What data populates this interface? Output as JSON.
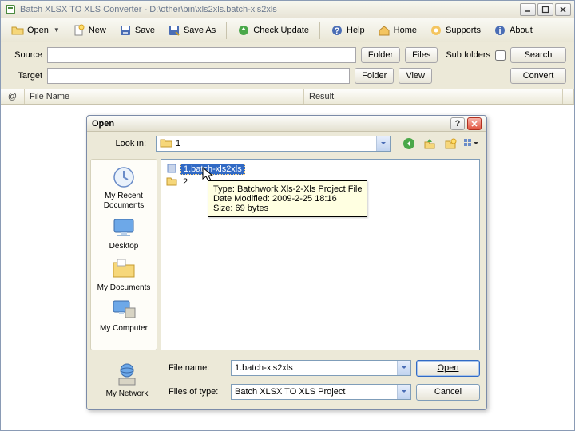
{
  "title": "Batch XLSX TO XLS Converter - D:\\other\\bin\\xls2xls.batch-xls2xls",
  "toolbar": {
    "open": "Open",
    "new": "New",
    "save": "Save",
    "save_as": "Save As",
    "check_update": "Check Update",
    "help": "Help",
    "home": "Home",
    "supports": "Supports",
    "about": "About"
  },
  "rows": {
    "source": "Source",
    "target": "Target",
    "folder": "Folder",
    "files": "Files",
    "subfolders": "Sub folders",
    "search": "Search",
    "view": "View",
    "convert": "Convert"
  },
  "grid": {
    "at": "@",
    "filename": "File Name",
    "result": "Result"
  },
  "dialog": {
    "title": "Open",
    "look_in": "Look in:",
    "look_in_value": "1",
    "places": {
      "recent": "My Recent Documents",
      "desktop": "Desktop",
      "docs": "My Documents",
      "computer": "My Computer",
      "network": "My Network"
    },
    "files": [
      {
        "name": "1.batch-xls2xls",
        "type": "project",
        "selected": true
      },
      {
        "name": "2",
        "type": "folder",
        "selected": false
      }
    ],
    "tooltip": {
      "l1": "Type: Batchwork Xls-2-Xls Project File",
      "l2": "Date Modified: 2009-2-25 18:16",
      "l3": "Size: 69 bytes"
    },
    "filename_label": "File name:",
    "filename_value": "1.batch-xls2xls",
    "filetype_label": "Files of type:",
    "filetype_value": "Batch XLSX TO XLS Project",
    "open_btn": "Open",
    "cancel_btn": "Cancel"
  }
}
